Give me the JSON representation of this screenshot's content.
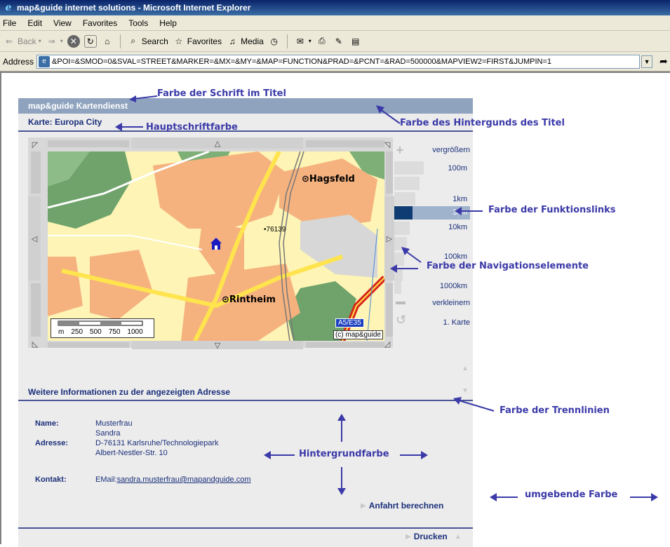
{
  "window": {
    "title": "map&guide internet solutions - Microsoft Internet Explorer"
  },
  "menu": {
    "items": [
      "File",
      "Edit",
      "View",
      "Favorites",
      "Tools",
      "Help"
    ]
  },
  "toolbar": {
    "back_label": "Back",
    "search_label": "Search",
    "favorites_label": "Favorites",
    "media_label": "Media"
  },
  "address": {
    "label": "Address",
    "value": "&POI=&SMOD=0&SVAL=STREET&MARKER=&MX=&MY=&MAP=FUNCTION&PRAD=&PCNT=&RAD=500000&MAPVIEW2=FIRST&JUMPIN=1"
  },
  "panel": {
    "title": "map&guide Kartendienst",
    "map_heading": "Karte: Europa City",
    "info_heading": "Weitere Informationen zu der angezeigten Adresse"
  },
  "map": {
    "places": {
      "hagsfeld": "Hagsfeld",
      "rintheim": "Rintheim",
      "postcode": "76139"
    },
    "scale_units": "m",
    "scale_ticks": [
      "250",
      "500",
      "750",
      "1000"
    ],
    "copyright": "(c) map&guide",
    "road_badge": "A5/E35"
  },
  "zoom": {
    "zoom_in": "vergrößern",
    "levels": [
      "100m",
      "1km",
      "3km",
      "10km",
      "100km",
      "1000km"
    ],
    "active_level": "3km",
    "zoom_out": "verkleinern",
    "first_map": "1. Karte"
  },
  "info": {
    "name_key": "Name:",
    "name_line1": "Musterfrau",
    "name_line2": "Sandra",
    "address_key": "Adresse:",
    "address_line1": "D-76131 Karlsruhe/Technologiepark",
    "address_line2": "Albert-Nestler-Str. 10",
    "contact_key": "Kontakt:",
    "contact_prefix": "EMail:",
    "email": "sandra.musterfrau@mapandguide.com"
  },
  "actions": {
    "route": "Anfahrt berechnen",
    "print": "Drucken"
  },
  "annotations": {
    "title_font_color": "Farbe der Schrift im Titel",
    "main_font_color": "Hauptschriftfarbe",
    "title_bg_color": "Farbe des Hintergunds des Titel",
    "function_links_color": "Farbe der Funktionslinks",
    "nav_elements_color": "Farbe der Navigationselemente",
    "separator_color": "Farbe der Trennlinien",
    "background_color": "Hintergrundfarbe",
    "surrounding_color": "umgebende Farbe"
  },
  "colors": {
    "title_bg": "#8fa3bf",
    "panel_bg": "#ececec",
    "main_text": "#1a2f7a",
    "separator": "#4a5596",
    "annotation": "#3b3aa8",
    "active_zoom": "#0f3d73"
  }
}
